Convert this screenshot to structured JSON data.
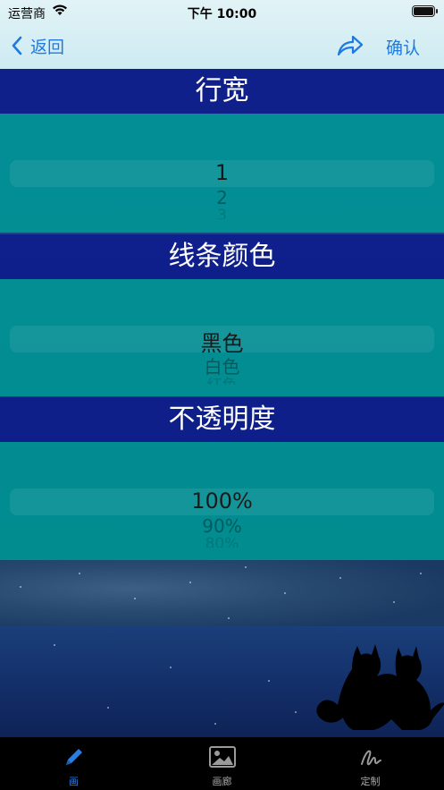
{
  "status_bar": {
    "carrier": "运营商",
    "time": "下午 10:00"
  },
  "nav": {
    "back_label": "返回",
    "confirm_label": "确认",
    "back_icon": "chevron-left-icon",
    "share_icon": "share-arrow-icon"
  },
  "sections": [
    {
      "title": "行宽",
      "options": [
        "1",
        "2",
        "3"
      ],
      "selected": "1"
    },
    {
      "title": "线条颜色",
      "options": [
        "黑色",
        "白色",
        "红色"
      ],
      "selected": "黑色"
    },
    {
      "title": "不透明度",
      "options": [
        "100%",
        "90%",
        "80%"
      ],
      "selected": "100%"
    }
  ],
  "tabbar": {
    "items": [
      {
        "label": "画",
        "icon": "pencil-icon",
        "active": true
      },
      {
        "label": "画廊",
        "icon": "image-icon",
        "active": false
      },
      {
        "label": "定制",
        "icon": "signature-icon",
        "active": false
      }
    ]
  },
  "colors": {
    "accent": "#1f7ae0",
    "header_band": "#0e1c8c",
    "picker_bg": "#009696",
    "tab_active": "#2a7de1"
  }
}
